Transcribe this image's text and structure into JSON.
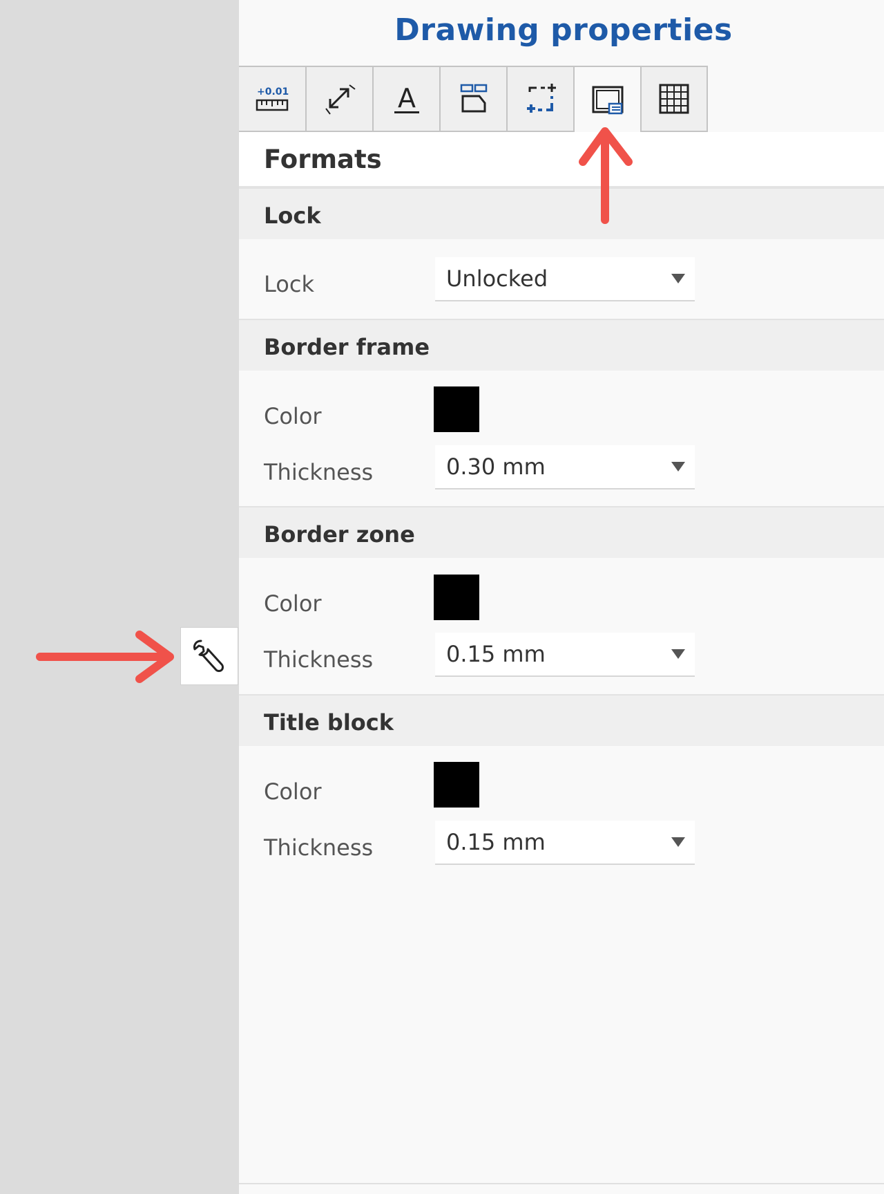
{
  "panel": {
    "title": "Drawing properties",
    "tabs": [
      {
        "icon": "dimension-tolerance-icon",
        "label": "+0.01"
      },
      {
        "icon": "arrow-leader-icon"
      },
      {
        "icon": "text-icon",
        "label": "A"
      },
      {
        "icon": "layout-icon"
      },
      {
        "icon": "dashed-region-icon"
      },
      {
        "icon": "sheet-format-icon",
        "active": true
      },
      {
        "icon": "table-grid-icon"
      }
    ],
    "section_title": "Formats"
  },
  "lock": {
    "header": "Lock",
    "label": "Lock",
    "value": "Unlocked"
  },
  "border_frame": {
    "header": "Border frame",
    "color_label": "Color",
    "color": "#000000",
    "thickness_label": "Thickness",
    "thickness": "0.30 mm"
  },
  "border_zone": {
    "header": "Border zone",
    "color_label": "Color",
    "color": "#000000",
    "thickness_label": "Thickness",
    "thickness": "0.15 mm"
  },
  "title_block": {
    "header": "Title block",
    "color_label": "Color",
    "color": "#000000",
    "thickness_label": "Thickness",
    "thickness": "0.15 mm"
  },
  "side_button": {
    "icon": "wrench-icon"
  },
  "colors": {
    "accent": "#1e5aa8",
    "annotation_arrow": "#f0524a"
  }
}
